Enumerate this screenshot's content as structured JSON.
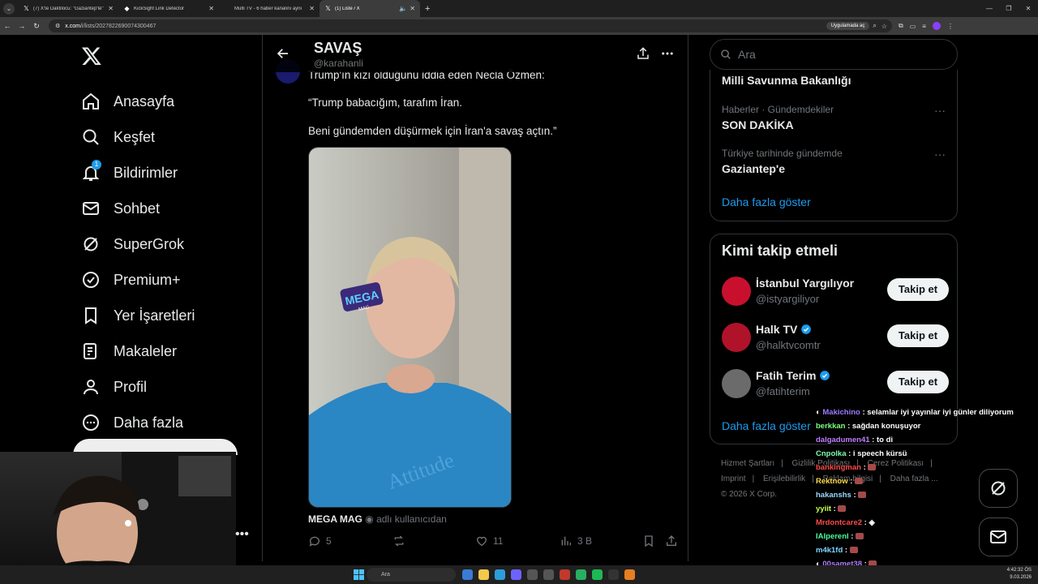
{
  "browser": {
    "tabs": [
      {
        "title": "(7) X'te Daktilocu: \"Gaziantep'te\"",
        "active": false
      },
      {
        "title": "KickSight Link Detector",
        "active": false
      },
      {
        "title": "Multi TV - 6 haber kanalını aynı",
        "active": false
      },
      {
        "title": "(1) Liste / X",
        "active": true
      }
    ],
    "url_domain": "x.com",
    "url_path": "/i/lists/2027822690074300467",
    "url_pill": "Uygulamada aç"
  },
  "nav": {
    "items": [
      {
        "label": "Anasayfa",
        "icon": "home-icon"
      },
      {
        "label": "Keşfet",
        "icon": "search-icon"
      },
      {
        "label": "Bildirimler",
        "icon": "bell-icon",
        "badge": "1"
      },
      {
        "label": "Sohbet",
        "icon": "mail-icon"
      },
      {
        "label": "SuperGrok",
        "icon": "grok-icon"
      },
      {
        "label": "Premium+",
        "icon": "verified-icon"
      },
      {
        "label": "Yer İşaretleri",
        "icon": "bookmark-icon"
      },
      {
        "label": "Makaleler",
        "icon": "article-icon"
      },
      {
        "label": "Profil",
        "icon": "person-icon"
      },
      {
        "label": "Daha fazla",
        "icon": "more-circle-icon"
      }
    ]
  },
  "main": {
    "title": "SAVAŞ",
    "handle": "@karahanli",
    "post": {
      "line1": "Trump'ın kızı olduğunu iddia eden Necla Özmen:",
      "line2": "“Trump babacığım, tarafım İran.",
      "line3": "Beni gündemden düşürmek için İran'a savaş açtın.”",
      "video_watermark": "MEGA",
      "video_watermark_sub": "MAG",
      "shirt_text": "Attitude",
      "credit_name": "MEGA MAG",
      "credit_suffix": "adlı kullanıcıdan",
      "replies": "5",
      "reposts": "",
      "likes": "11",
      "views": "3 B"
    }
  },
  "right": {
    "search_placeholder": "Ara",
    "trends": [
      {
        "meta": "",
        "name": "Milli Savunma Bakanlığı"
      },
      {
        "meta": "Haberler · Gündemdekiler",
        "name": "SON DAKİKA"
      },
      {
        "meta": "Türkiye tarihinde gündemde",
        "name": "Gaziantep'e"
      }
    ],
    "trends_more": "Daha fazla göster",
    "follow_title": "Kimi takip etmeli",
    "follow": [
      {
        "name": "İstanbul Yargılıyor",
        "handle": "@istyargiliyor",
        "verified": false,
        "color": "#c8102e"
      },
      {
        "name": "Halk TV",
        "handle": "@halktvcomtr",
        "verified": true,
        "color": "#b0122a"
      },
      {
        "name": "Fatih Terim",
        "handle": "@fatihterim",
        "verified": true,
        "color": "#6b6b6b"
      }
    ],
    "follow_button": "Takip et",
    "follow_more": "Daha fazla göster",
    "footer": [
      "Hizmet Şartları",
      "Gizlilik Politikası",
      "Çerez Politikası",
      "Imprint",
      "Erişilebilirlik",
      "Reklam bilgisi",
      "Daha fazla ...",
      "© 2026 X Corp."
    ]
  },
  "chat": [
    {
      "user": "Makichino",
      "text": ": selamlar iyi yayınlar iyi günler diliyorum",
      "color": "#9b7bff"
    },
    {
      "user": "berkkan",
      "text": ": sağdan konuşuyor",
      "color": "#7dff7d"
    },
    {
      "user": "dalgadumen41",
      "text": ": to di",
      "color": "#bf7dff"
    },
    {
      "user": "Cnpolka",
      "text": ": i speech kürsü",
      "color": "#7dffb0"
    },
    {
      "user": "bankingman",
      "text": ":",
      "color": "#ff4a4a"
    },
    {
      "user": "Rektnow",
      "text": ":",
      "color": "#ffd84a"
    },
    {
      "user": "hakanshs",
      "text": ":",
      "color": "#9ad7ff"
    },
    {
      "user": "yyiit",
      "text": ":",
      "color": "#c8ff4a"
    },
    {
      "user": "Mrdontcare2",
      "text": ":",
      "color": "#ff4a4a"
    },
    {
      "user": "IAlperenl",
      "text": ":",
      "color": "#4aff9a"
    },
    {
      "user": "m4k1fd",
      "text": ":",
      "color": "#7dd7ff"
    },
    {
      "user": "00samet38",
      "text": ":",
      "color": "#b07dff"
    }
  ],
  "taskbar": {
    "search_label": "Ara",
    "time": "4:42:32 ÖS",
    "date": "9.03.2026"
  }
}
